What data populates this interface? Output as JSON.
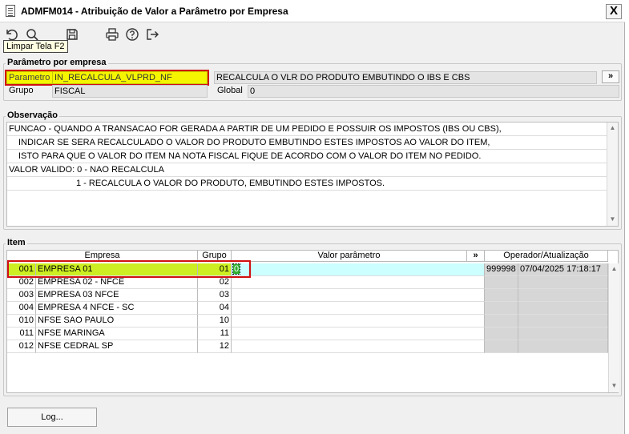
{
  "window": {
    "title": "ADMFM014 - Atribuição de Valor a Parâmetro por Empresa",
    "close_label": "X"
  },
  "toolbar": {
    "tooltip": "Limpar Tela F2",
    "icons": [
      "undo-icon",
      "search-icon",
      "save-icon",
      "print-icon",
      "help-icon",
      "exit-icon"
    ]
  },
  "parametro": {
    "legend": "Parâmetro por empresa",
    "parametro_label": "Parametro",
    "parametro_value": "IN_RECALCULA_VLPRD_NF",
    "descricao_value": "RECALCULA O VLR DO PRODUTO EMBUTINDO O IBS E CBS",
    "more_label": "»",
    "grupo_label": "Grupo",
    "grupo_value": "FISCAL",
    "global_label": "Global",
    "global_value": "0"
  },
  "observacao": {
    "legend": "Observação",
    "lines": [
      "FUNCAO - QUANDO A TRANSACAO FOR GERADA A PARTIR DE UM PEDIDO E POSSUIR OS IMPOSTOS (IBS OU CBS),",
      "INDICAR SE SERA RECALCULADO O VALOR DO PRODUTO EMBUTINDO ESTES IMPOSTOS AO VALOR DO ITEM,",
      "ISTO PARA QUE O VALOR DO ITEM NA NOTA FISCAL FIQUE DE ACORDO COM O VALOR DO ITEM NO PEDIDO.",
      "VALOR VALIDO: 0 - NAO RECALCULA",
      "1 - RECALCULA O VALOR DO PRODUTO, EMBUTINDO ESTES IMPOSTOS."
    ]
  },
  "item": {
    "legend": "Item",
    "headers": {
      "empresa": "Empresa",
      "grupo": "Grupo",
      "valor": "Valor parâmetro",
      "more": "»",
      "operador": "Operador/Atualização"
    },
    "rows": [
      {
        "codigo": "001",
        "nome": "EMPRESA 01",
        "grupo": "01",
        "valor": "0",
        "operador": "999998",
        "atualizacao": "07/04/2025 17:18:17"
      },
      {
        "codigo": "002",
        "nome": "EMPRESA 02 - NFCE",
        "grupo": "02",
        "valor": "",
        "operador": "",
        "atualizacao": ""
      },
      {
        "codigo": "003",
        "nome": "EMPRESA 03 NFCE",
        "grupo": "03",
        "valor": "",
        "operador": "",
        "atualizacao": ""
      },
      {
        "codigo": "004",
        "nome": "EMPRESA 4 NFCE - SC",
        "grupo": "04",
        "valor": "",
        "operador": "",
        "atualizacao": ""
      },
      {
        "codigo": "010",
        "nome": "NFSE SAO PAULO",
        "grupo": "10",
        "valor": "",
        "operador": "",
        "atualizacao": ""
      },
      {
        "codigo": "011",
        "nome": "NFSE MARINGA",
        "grupo": "11",
        "valor": "",
        "operador": "",
        "atualizacao": ""
      },
      {
        "codigo": "012",
        "nome": "NFSE CEDRAL SP",
        "grupo": "12",
        "valor": "",
        "operador": "",
        "atualizacao": ""
      }
    ]
  },
  "footer": {
    "log_label": "Log..."
  }
}
